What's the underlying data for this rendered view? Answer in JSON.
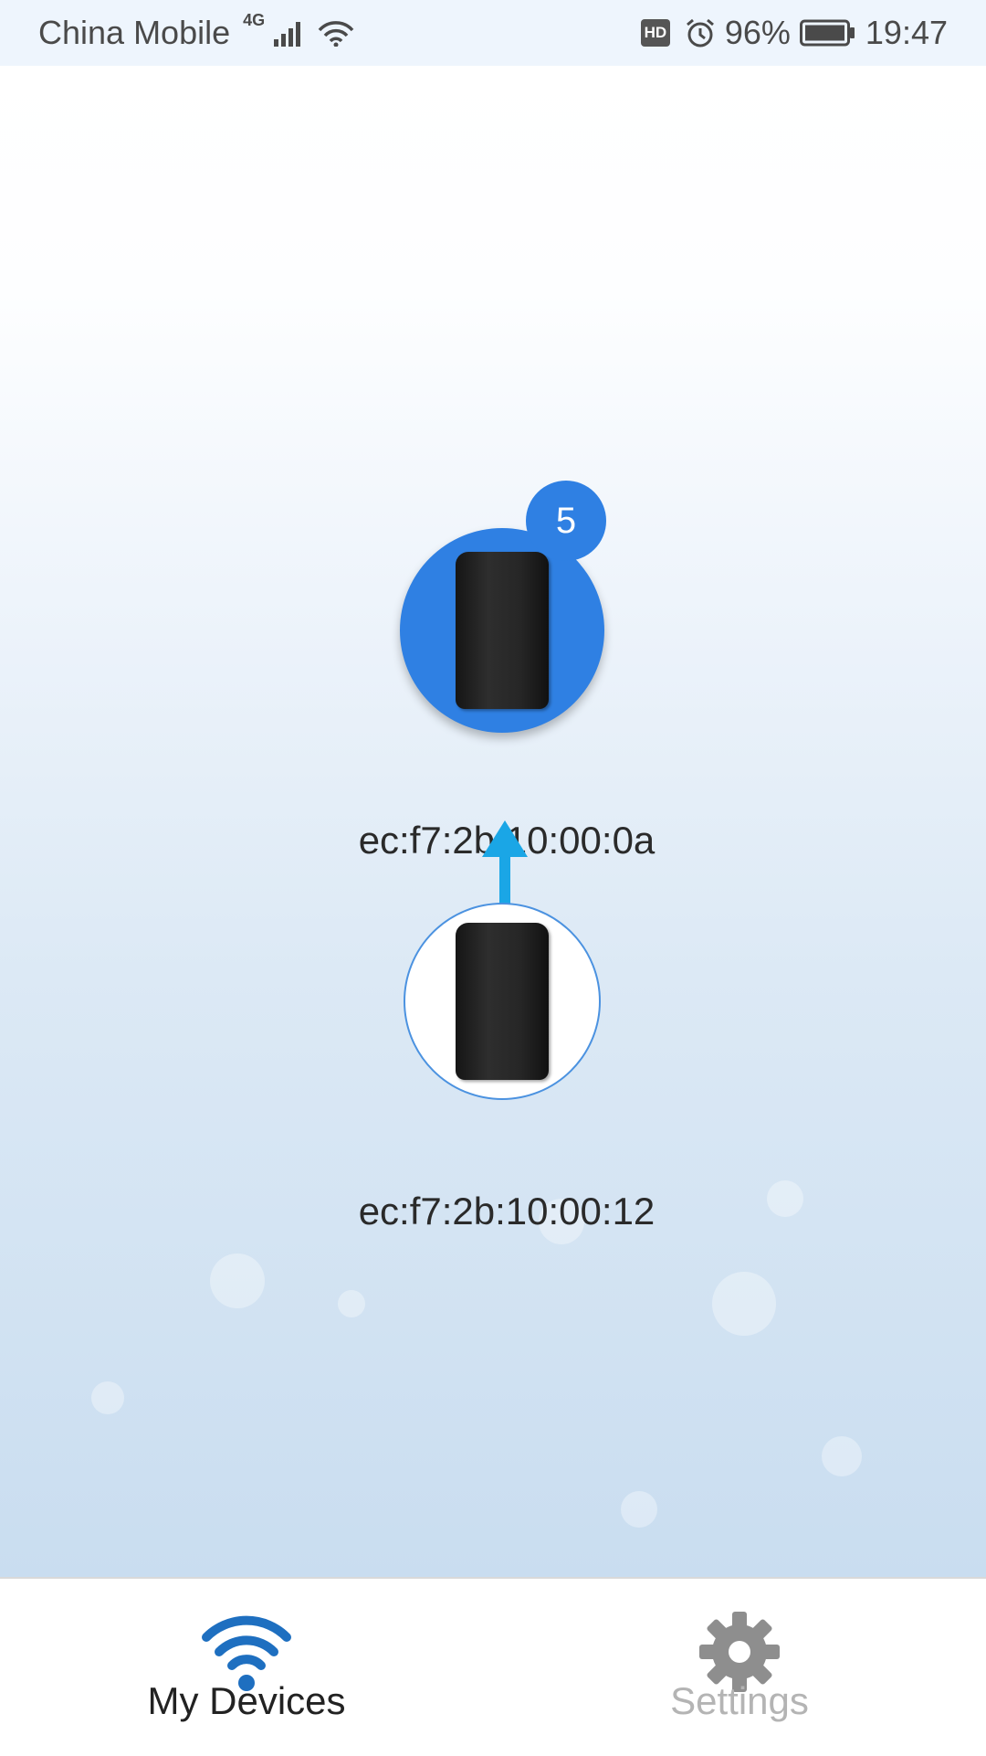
{
  "status_bar": {
    "carrier": "China Mobile",
    "network": "4G",
    "hd": "HD",
    "battery": "96%",
    "time": "19:47"
  },
  "mesh": {
    "primary": {
      "mac": "ec:f7:2b:10:00:0a",
      "client_count": "5"
    },
    "secondary": {
      "mac": "ec:f7:2b:10:00:12"
    }
  },
  "bottom_nav": {
    "items": [
      {
        "label": "My Devices",
        "icon": "wifi-icon",
        "active": true
      },
      {
        "label": "Settings",
        "icon": "gear-icon",
        "active": false
      }
    ]
  },
  "colors": {
    "accent": "#2f80e3",
    "arrow": "#1aa6e6",
    "inactive": "#b4b4b4"
  }
}
